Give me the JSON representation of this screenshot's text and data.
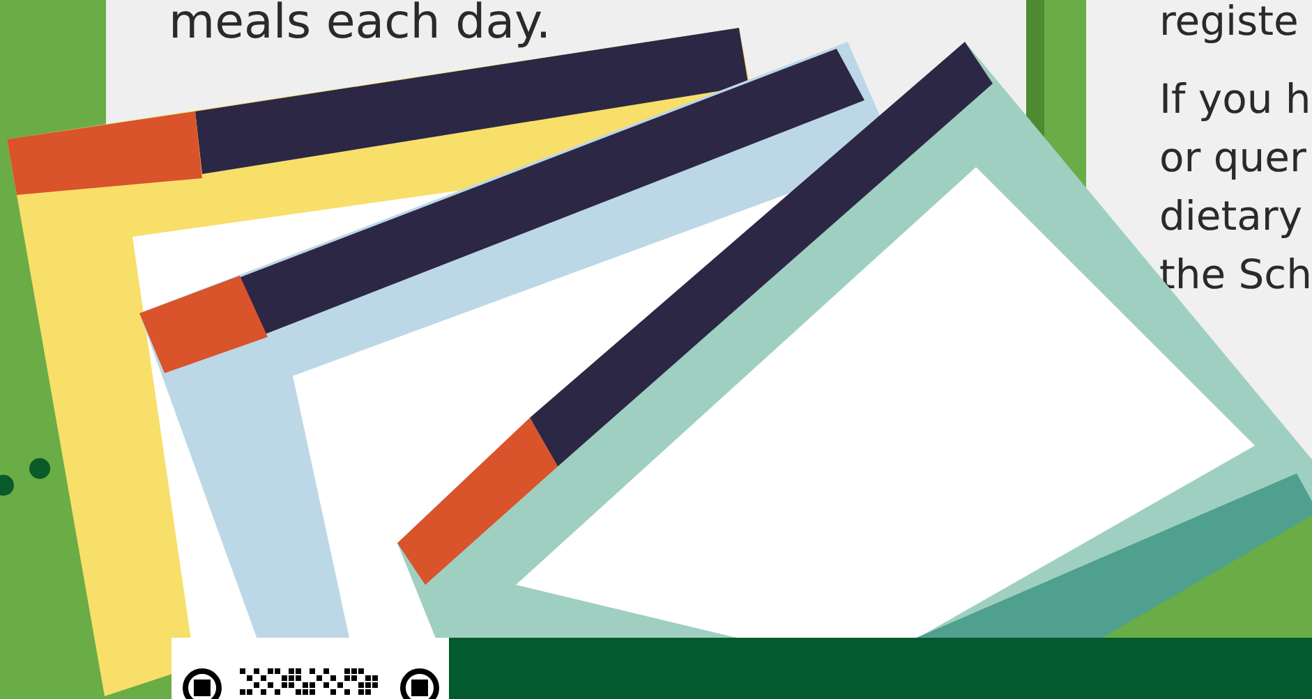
{
  "intro": {
    "text": "meals each day."
  },
  "side_panel": {
    "paragraphs": [
      {
        "lines": [
          "registe"
        ]
      },
      {
        "lines": [
          "If you h",
          "or quer",
          "dietary",
          "the Sch"
        ]
      }
    ]
  }
}
